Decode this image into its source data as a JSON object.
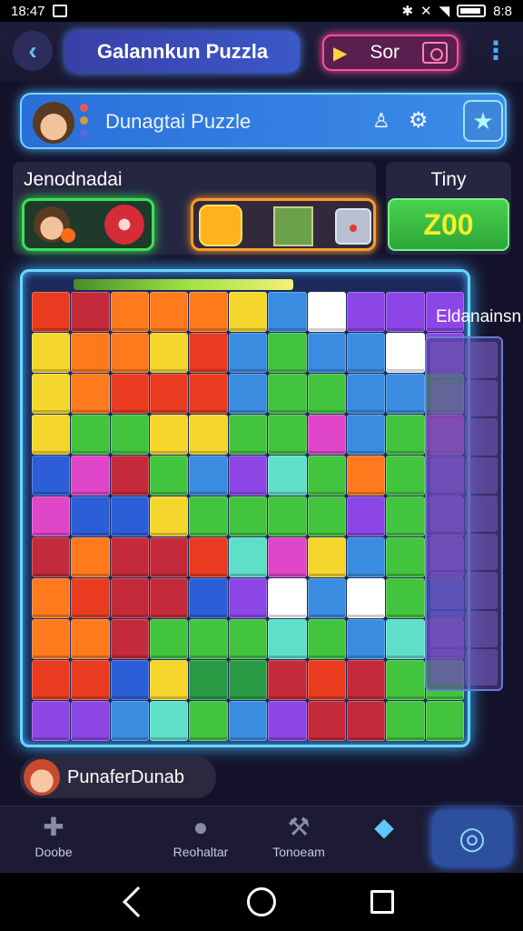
{
  "status_bar": {
    "time": "18:47",
    "time_right": "8:8"
  },
  "app_bar": {
    "back_icon": "chevron-left-icon",
    "title": "Galannkun Puzzla",
    "score_label": "Sor",
    "menu_icon": "more-vertical-icon"
  },
  "header_card": {
    "title": "Dunagtai Puzzle",
    "dot_colors": [
      "#e85a5a",
      "#d99a3a",
      "#5a6ad8"
    ]
  },
  "left_panel": {
    "label": "Jenodnadai"
  },
  "timer_panel": {
    "label": "Tiny",
    "value": "Z00"
  },
  "side_panel": {
    "label": "Eldanainsn"
  },
  "player": {
    "name": "PunaferDunab"
  },
  "bottom_nav": {
    "items": [
      {
        "label": "Doobe",
        "icon": "puzzle-piece-icon"
      },
      {
        "label": "Reohaltar",
        "icon": "bag-icon"
      },
      {
        "label": "Tonoeam",
        "icon": "hammer-icon"
      },
      {
        "label": "",
        "icon": "diamond-icon"
      },
      {
        "label": "",
        "icon": "target-icon"
      }
    ]
  },
  "board": {
    "rows": 11,
    "cols": 11,
    "palette": [
      "#e83b1f",
      "#ff7a1c",
      "#f4d62c",
      "#43c43e",
      "#2a9a45",
      "#3a8ce0",
      "#2c5ed8",
      "#8c46e6",
      "#e046c8",
      "#5ee0c8",
      "#ffffff",
      "#c42a3a"
    ],
    "cells": [
      [
        0,
        11,
        1,
        1,
        1,
        2,
        5,
        10,
        7,
        7,
        7
      ],
      [
        2,
        1,
        1,
        2,
        0,
        5,
        3,
        5,
        5,
        10,
        7
      ],
      [
        2,
        1,
        0,
        0,
        0,
        5,
        3,
        3,
        5,
        5,
        3
      ],
      [
        2,
        3,
        3,
        2,
        2,
        3,
        3,
        8,
        5,
        3,
        8
      ],
      [
        6,
        8,
        11,
        3,
        5,
        7,
        9,
        3,
        1,
        3,
        7
      ],
      [
        8,
        6,
        6,
        2,
        3,
        3,
        3,
        3,
        7,
        3,
        7
      ],
      [
        11,
        1,
        11,
        11,
        0,
        9,
        8,
        2,
        5,
        3,
        7
      ],
      [
        1,
        0,
        11,
        11,
        6,
        7,
        10,
        5,
        10,
        3,
        6
      ],
      [
        1,
        1,
        11,
        3,
        3,
        3,
        9,
        3,
        5,
        9,
        7
      ],
      [
        0,
        0,
        6,
        2,
        4,
        4,
        11,
        0,
        11,
        3,
        3
      ],
      [
        7,
        7,
        5,
        9,
        3,
        5,
        7,
        11,
        11,
        3,
        3
      ]
    ]
  }
}
